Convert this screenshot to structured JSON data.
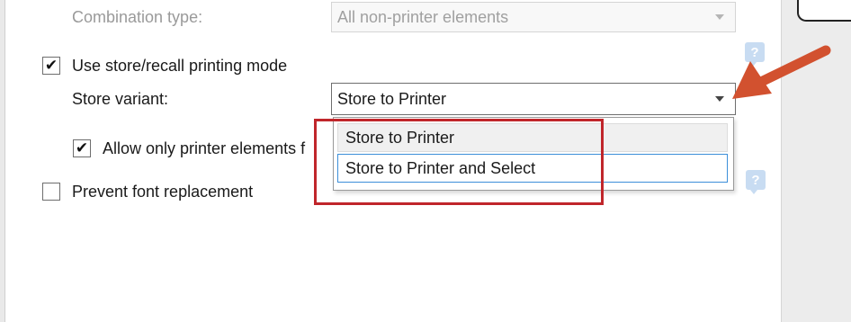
{
  "settings": {
    "combination_type": {
      "label": "Combination type:",
      "value": "All non-printer elements"
    },
    "store_recall": {
      "label": "Use store/recall printing mode",
      "checked": true
    },
    "store_variant": {
      "label": "Store variant:",
      "value": "Store to Printer",
      "options": [
        "Store to Printer",
        "Store to Printer and Select"
      ]
    },
    "allow_only_printer_elements": {
      "label": "Allow only printer elements f",
      "checked": true
    },
    "prevent_font_replacement": {
      "label": "Prevent font replacement",
      "checked": false
    },
    "help_glyph": "?",
    "check_glyph": "✔"
  },
  "annotations": {
    "highlight_color": "#c0262b",
    "arrow_color": "#d2512f"
  },
  "icons": {
    "help": "help-icon",
    "dropdown": "chevron-down-icon",
    "check": "checkmark-icon",
    "annotation_arrow": "arrow-icon"
  }
}
